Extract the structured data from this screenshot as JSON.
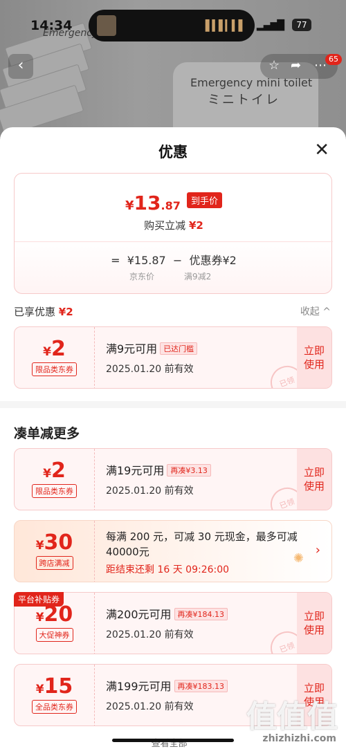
{
  "status": {
    "time": "14:34",
    "battery": "77",
    "signal": "▂▄▆█"
  },
  "product": {
    "label_top": "Emergency",
    "label_main": "Emergency mini toilet",
    "label_jp": "ミニトイレ"
  },
  "header_actions": {
    "back_icon": "chevron-left-icon",
    "star_icon": "star-icon",
    "share_icon": "share-icon",
    "more_icon": "more-icon",
    "badge": "65"
  },
  "sheet": {
    "title": "优惠",
    "close": "✕",
    "summary": {
      "yen": "¥",
      "price_int": "13",
      "price_dec": ".87",
      "tag": "到手价",
      "reduce_label": "购买立减",
      "reduce_value": "¥2",
      "formula_eq": "=",
      "base_price": "¥15.87",
      "minus": "−",
      "coupon_part": "优惠券¥2",
      "base_label": "京东价",
      "coupon_label": "满9减2"
    },
    "enjoyed": {
      "label": "已享优惠",
      "value": "¥2",
      "collapse": "收起 ^"
    },
    "enjoyed_coupon": {
      "yen": "¥",
      "amount": "2",
      "tag": "限品类东券",
      "condition": "满9元可用",
      "pill": "已达门槛",
      "expiry": "2025.01.20 前有效",
      "action_line1": "立即",
      "action_line2": "使用",
      "stamp": "已领"
    },
    "more_title": "凑单减更多",
    "coupons": [
      {
        "yen": "¥",
        "amount": "2",
        "tag": "限品类东券",
        "condition": "满19元可用",
        "pill": "再凑¥3.13",
        "expiry": "2025.01.20 前有效",
        "action_line1": "立即",
        "action_line2": "使用",
        "stamp": "已领"
      },
      {
        "yen": "¥",
        "amount": "30",
        "tag": "跨店满减",
        "desc": "每满 200 元，可减 30 元现金，最多可减40000元",
        "countdown": "距结束还剩 16 天 09:26:00",
        "arrow": "›"
      },
      {
        "platform_tag": "平台补贴券",
        "yen": "¥",
        "amount": "20",
        "tag": "大促神券",
        "condition": "满200元可用",
        "pill": "再凑¥184.13",
        "expiry": "2025.01.20 前有效",
        "action_line1": "立即",
        "action_line2": "使用",
        "stamp": "已领"
      },
      {
        "yen": "¥",
        "amount": "15",
        "tag": "全品类东券",
        "condition": "满199元可用",
        "pill": "再凑¥183.13",
        "expiry": "2025.01.20 前有效",
        "action_line1": "立即",
        "action_line2": "使用"
      }
    ],
    "see_all": "查看全部 ˅"
  },
  "watermark": {
    "text": "值值值",
    "url": "zhizhizhi.com"
  }
}
